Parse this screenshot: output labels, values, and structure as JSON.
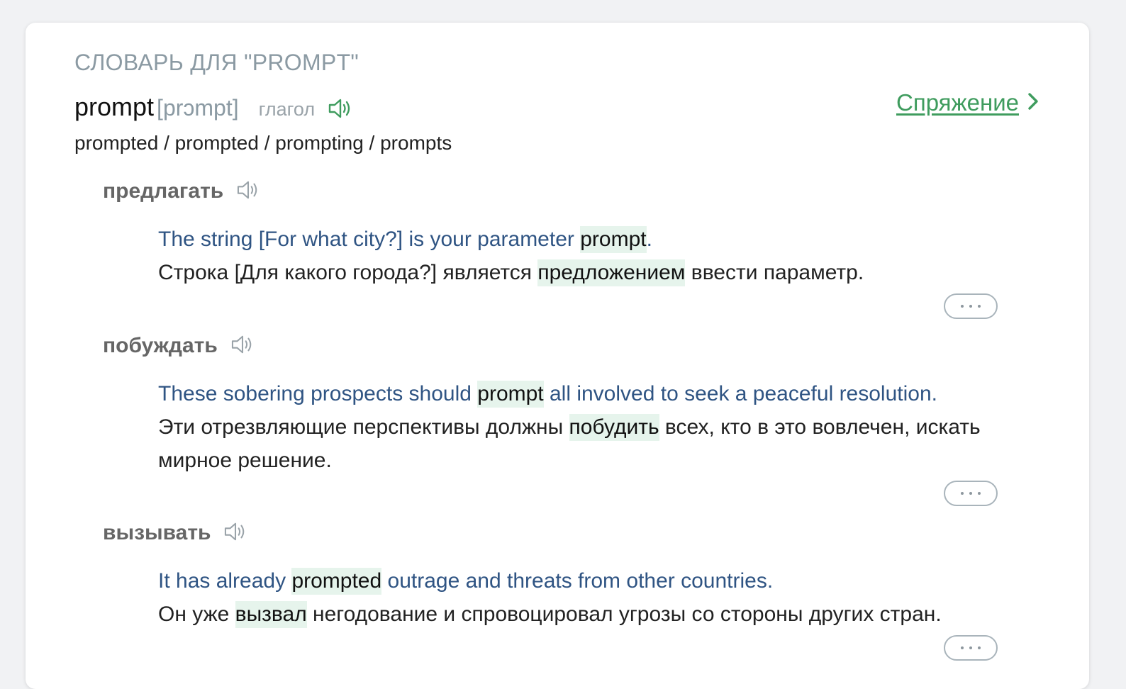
{
  "heading": "СЛОВАРЬ ДЛЯ \"PROMPT\"",
  "entry": {
    "word": "prompt",
    "transcription": "[prɔmpt]",
    "part_of_speech": "глагол",
    "forms": "prompted / prompted / prompting / prompts"
  },
  "conjugation_link": "Спряжение",
  "senses": [
    {
      "translation": "предлагать",
      "example_en": {
        "before": "The string [For what city?] is your parameter ",
        "highlight": "prompt",
        "after": "."
      },
      "example_ru": {
        "before": "Строка [Для какого города?] является ",
        "highlight": "предложением",
        "after": " ввести параметр."
      }
    },
    {
      "translation": "побуждать",
      "example_en": {
        "before": "These sobering prospects should ",
        "highlight": "prompt",
        "after": " all involved to seek a peaceful resolution."
      },
      "example_ru": {
        "before": "Эти отрезвляющие перспективы должны ",
        "highlight": "побудить",
        "after": " всех, кто в это вовлечен, искать мирное решение."
      }
    },
    {
      "translation": "вызывать",
      "example_en": {
        "before": "It has already ",
        "highlight": "prompted",
        "after": " outrage and threats from other countries."
      },
      "example_ru": {
        "before": "Он уже ",
        "highlight": "вызвал",
        "after": " негодование и спровоцировал угрозы со стороны других стран."
      }
    }
  ],
  "icons": {
    "speaker": "speaker-icon",
    "chevron": "chevron-right-icon",
    "more": "more-dots-icon"
  },
  "colors": {
    "accent_green": "#3f9c5e",
    "example_blue": "#2f5483",
    "highlight_bg": "#e6f4ec"
  }
}
